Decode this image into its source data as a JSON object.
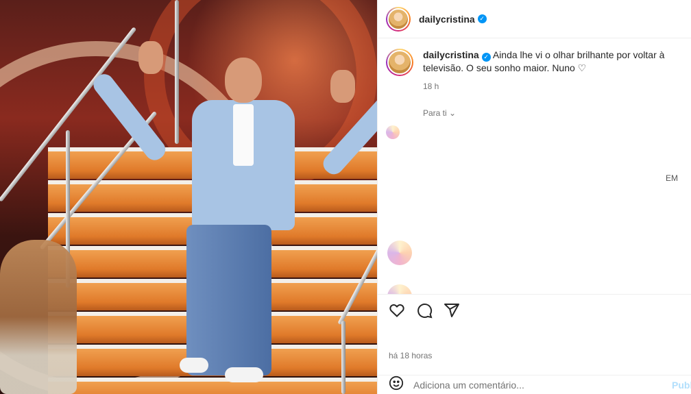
{
  "post": {
    "username": "dailycristina",
    "caption_text": "Ainda lhe vi o olhar brilhante por voltar à televisão. O seu sonho maior. Nuno ♡",
    "caption_time": "18 h",
    "for_you_label": "Para ti ⌄",
    "time_ago": "há 18 horas"
  },
  "blurred_comments": {
    "fragment_1": "EM"
  },
  "actions": {
    "like_icon": "heart-icon",
    "comment_icon": "comment-icon",
    "share_icon": "send-icon"
  },
  "comment_input": {
    "placeholder": "Adiciona um comentário...",
    "publish_label": "Publicar"
  },
  "colors": {
    "verified": "#0095f6",
    "publish": "#b2dffc",
    "muted_text": "#737373"
  }
}
